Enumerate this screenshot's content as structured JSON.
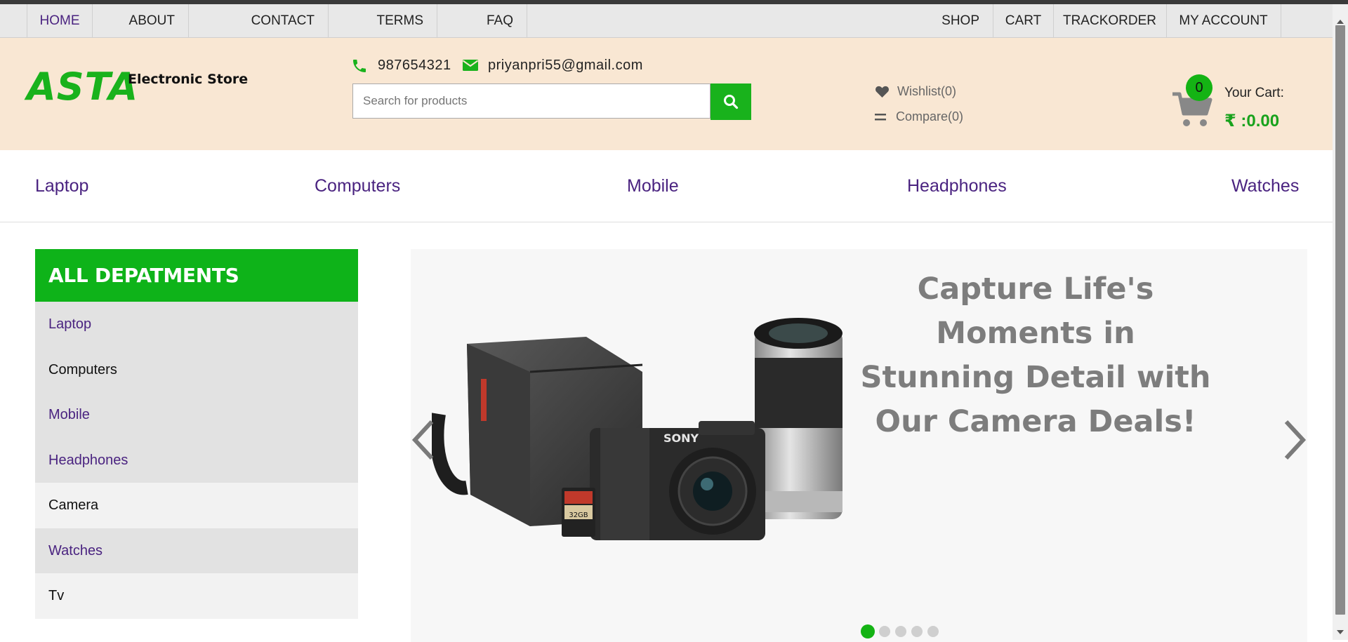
{
  "topnav": {
    "left": [
      "HOME",
      "ABOUT",
      "CONTACT",
      "TERMS",
      "FAQ"
    ],
    "right": [
      "SHOP",
      "CART",
      "TRACKORDER",
      "MY ACCOUNT"
    ],
    "active": "HOME"
  },
  "header": {
    "logo": "ASTA",
    "logo_subtitle": "Electronic Store",
    "phone": "987654321",
    "email": "priyanpri55@gmail.com",
    "search_placeholder": "Search for products",
    "wishlist": "Wishlist(0)",
    "compare": "Compare(0)",
    "cart_count": "0",
    "cart_label": "Your Cart:",
    "cart_total": "₹ :0.00"
  },
  "categories": [
    "Laptop",
    "Computers",
    "Mobile",
    "Headphones",
    "Watches"
  ],
  "departments": {
    "title": "ALL DEPATMENTS",
    "items": [
      "Laptop",
      "Computers",
      "Mobile",
      "Headphones",
      "Camera",
      "Watches",
      "Tv"
    ]
  },
  "slider": {
    "headline": "Capture Life's Moments in Stunning Detail with Our Camera Deals!",
    "image_alt": "SONY",
    "active_slide": 1,
    "total_slides": 5,
    "sd_card_label": "32GB"
  },
  "colors": {
    "brand_green": "#19b21c",
    "nav_purple": "#4a2380",
    "header_bg": "#f9e7d3",
    "topbar_bg": "#e8e8e8"
  },
  "icons": {
    "phone": "phone-icon",
    "email": "envelope-icon",
    "search": "search-icon",
    "wishlist": "heart-icon",
    "compare": "compare-icon",
    "cart": "cart-icon",
    "prev": "chevron-left-icon",
    "next": "chevron-right-icon"
  }
}
